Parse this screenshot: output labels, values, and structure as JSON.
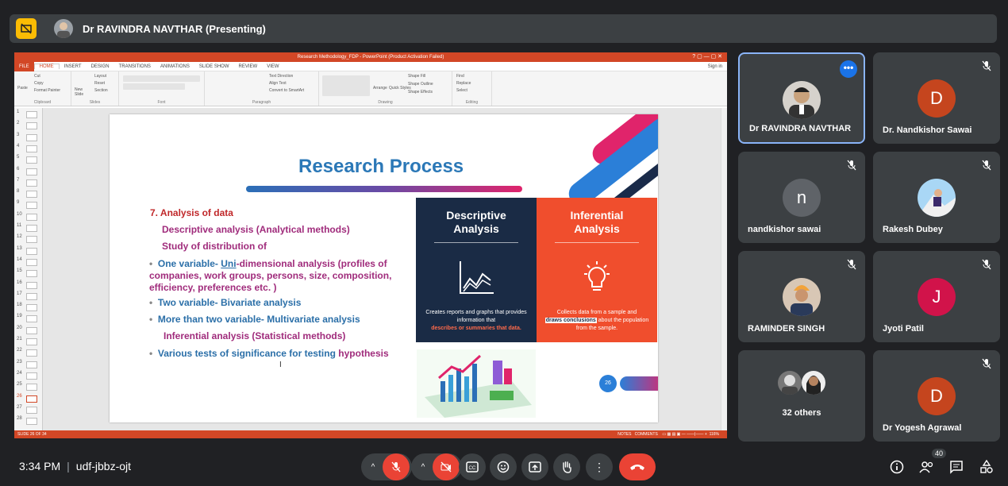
{
  "meeting": {
    "presenter_label": "Dr RAVINDRA NAVTHAR (Presenting)",
    "time": "3:34 PM",
    "code": "udf-jbbz-ojt",
    "people_count": "40"
  },
  "powerpoint": {
    "window_title": "Research Methodology_FDP - PowerPoint (Product Activation Failed)",
    "sign_in": "Sign in",
    "tabs": [
      "FILE",
      "HOME",
      "INSERT",
      "DESIGN",
      "TRANSITIONS",
      "ANIMATIONS",
      "SLIDE SHOW",
      "REVIEW",
      "VIEW"
    ],
    "groups": [
      "Clipboard",
      "Slides",
      "Font",
      "Paragraph",
      "Drawing",
      "Editing"
    ],
    "clipboard": {
      "paste": "Paste",
      "cut": "Cut",
      "copy": "Copy",
      "format_painter": "Format Painter"
    },
    "slides_group": {
      "new_slide": "New Slide",
      "layout": "Layout",
      "reset": "Reset",
      "section": "Section"
    },
    "paragraph": {
      "text_direction": "Text Direction",
      "align_text": "Align Text",
      "convert": "Convert to SmartArt"
    },
    "drawing": {
      "arrange": "Arrange",
      "quick_styles": "Quick Styles",
      "shape_fill": "Shape Fill",
      "shape_outline": "Shape Outline",
      "shape_effects": "Shape Effects"
    },
    "editing": {
      "find": "Find",
      "replace": "Replace",
      "select": "Select"
    },
    "status_left": "SLIDE 26 OF 34",
    "status_notes": "NOTES",
    "status_comments": "COMMENTS",
    "zoom": "116%",
    "thumb_numbers": [
      "1",
      "2",
      "3",
      "4",
      "5",
      "6",
      "7",
      "8",
      "9",
      "10",
      "11",
      "12",
      "13",
      "14",
      "15",
      "16",
      "17",
      "18",
      "19",
      "20",
      "21",
      "22",
      "23",
      "24",
      "25",
      "26",
      "27",
      "28"
    ]
  },
  "slide": {
    "title": "Research Process",
    "heading": "7. Analysis of data",
    "descriptive_line": "Descriptive analysis (Analytical methods)",
    "study_line": "Study of distribution of",
    "bullet1_a": "One variable-",
    "bullet1_b": "Uni",
    "bullet1_c": "-dimensional analysis  (profiles of",
    "bullet1_l2": "companies, work groups, persons,  size, composition,",
    "bullet1_l3": "efficiency, preferences etc. )",
    "bullet2": "Two variable-   Bivariate analysis",
    "bullet3": "More than two variable- Multivariate analysis",
    "inferential_line": "Inferential analysis (Statistical methods)",
    "bullet4_a": "Various tests of significance for testing",
    "bullet4_b": "hypothesis",
    "bullet_char": "•",
    "desc_title_1": "Descriptive",
    "desc_title_2": "Analysis",
    "desc_text_1": "Creates reports and graphs that provides information that",
    "desc_text_2": "describes or summaries that data.",
    "inf_title_1": "Inferential",
    "inf_title_2": "Analysis",
    "inf_text_1": "Collects data from a sample and",
    "inf_text_2": "draws conclusions",
    "inf_text_3": "about the population from the sample.",
    "slide_number": "26"
  },
  "participants": [
    {
      "name": "Dr RAVINDRA NAVTHAR",
      "initial": "",
      "color": "#3c4043"
    },
    {
      "name": "Dr. Nandkishor Sawai",
      "initial": "D",
      "color": "#c5451e"
    },
    {
      "name": "nandkishor sawai",
      "initial": "n",
      "color": "#5f6368"
    },
    {
      "name": "Rakesh Dubey",
      "initial": "",
      "color": "#a9d7f5"
    },
    {
      "name": "RAMINDER SINGH",
      "initial": "",
      "color": "#d8c7b5"
    },
    {
      "name": "Jyoti Patil",
      "initial": "J",
      "color": "#d1134a"
    },
    {
      "name": "32 others",
      "initial": "",
      "color": ""
    },
    {
      "name": "Dr Yogesh Agrawal",
      "initial": "D",
      "color": "#c5451e"
    }
  ],
  "colors": {
    "meet_bg": "#202124",
    "tile_bg": "#3c4043",
    "hangup": "#ea4335",
    "ppt_accent": "#d24726",
    "slide_blue": "#2b78b7",
    "desc_box": "#1a2b45",
    "inf_box": "#f04e2d"
  }
}
